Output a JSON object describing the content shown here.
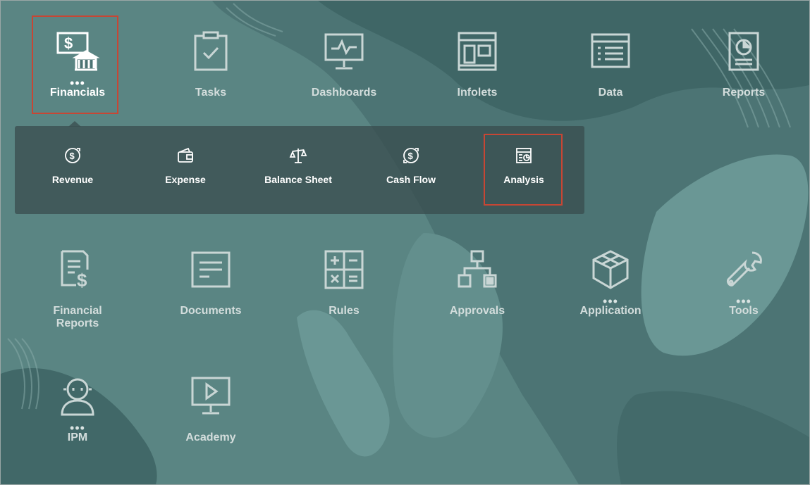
{
  "tiles": [
    {
      "label": "Financials",
      "icon": "financials-icon",
      "dots": "•••"
    },
    {
      "label": "Tasks",
      "icon": "tasks-icon"
    },
    {
      "label": "Dashboards",
      "icon": "dashboards-icon"
    },
    {
      "label": "Infolets",
      "icon": "infolets-icon"
    },
    {
      "label": "Data",
      "icon": "data-icon"
    },
    {
      "label": "Reports",
      "icon": "reports-icon"
    },
    {
      "label": "Financial Reports",
      "icon": "financial-reports-icon"
    },
    {
      "label": "Documents",
      "icon": "documents-icon"
    },
    {
      "label": "Rules",
      "icon": "rules-icon"
    },
    {
      "label": "Approvals",
      "icon": "approvals-icon"
    },
    {
      "label": "Application",
      "icon": "application-icon",
      "dots": "•••"
    },
    {
      "label": "Tools",
      "icon": "tools-icon",
      "dots": "•••"
    },
    {
      "label": "IPM",
      "icon": "ipm-icon",
      "dots": "•••"
    },
    {
      "label": "Academy",
      "icon": "academy-icon"
    }
  ],
  "submenu": {
    "items": [
      {
        "label": "Revenue",
        "icon": "revenue-icon"
      },
      {
        "label": "Expense",
        "icon": "expense-icon"
      },
      {
        "label": "Balance Sheet",
        "icon": "balance-sheet-icon"
      },
      {
        "label": "Cash Flow",
        "icon": "cash-flow-icon"
      },
      {
        "label": "Analysis",
        "icon": "analysis-icon"
      }
    ]
  },
  "colors": {
    "background": "#4c7474",
    "highlight_border": "#c74634",
    "icon_stroke": "#c9d6d5",
    "submenu_bg": "#3a4e50"
  }
}
